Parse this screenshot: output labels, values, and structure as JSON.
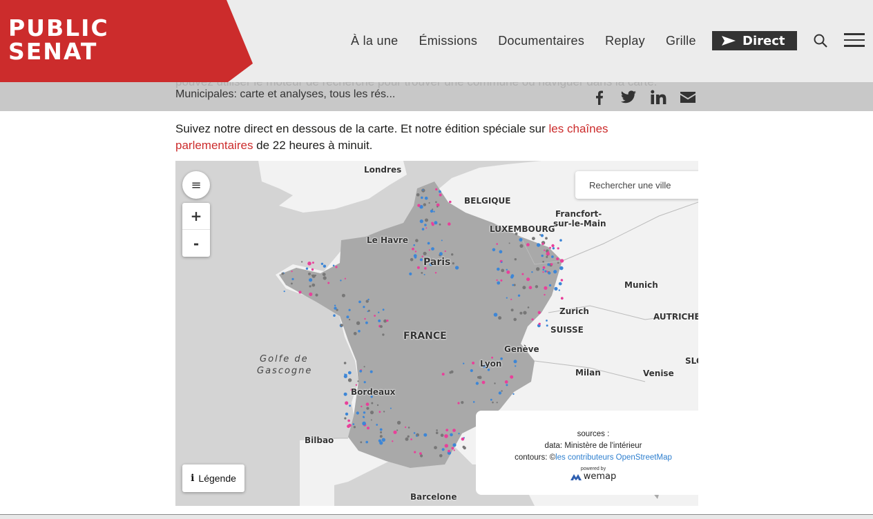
{
  "brand": {
    "logo_line1": "PUBLIC",
    "logo_line2": "SENAT",
    "color": "#cc2c2c"
  },
  "nav": {
    "items": [
      "À la une",
      "Émissions",
      "Documentaires",
      "Replay",
      "Grille"
    ],
    "direct_label": "Direct"
  },
  "share_bar": {
    "title": "Municipales: carte et analyses, tous les rés...",
    "behind_text": "pouvez utiliser le moteur de recherche pour trouver une commune ou naviguer dans la carte.",
    "icons": [
      "facebook-icon",
      "twitter-icon",
      "linkedin-icon",
      "mail-icon"
    ]
  },
  "article": {
    "text_before": "Suivez notre direct en dessous de la carte. Et notre édition spéciale sur ",
    "link_text": "les chaînes parlementaires",
    "text_after": " de 22 heures à minuit."
  },
  "map": {
    "search_placeholder": "Rechercher une ville",
    "zoom_in": "+",
    "zoom_out": "-",
    "legend_label": "Légende",
    "labels": {
      "londres": "Londres",
      "belgique": "BELGIQUE",
      "francfort1": "Francfort-",
      "francfort2": "sur-le-Main",
      "luxembourg": "LUXEMBOURG",
      "le_havre": "Le Havre",
      "paris": "Paris",
      "munich": "Munich",
      "zurich": "Zurich",
      "autriche": "AUTRICHE",
      "suisse": "SUISSE",
      "france": "FRANCE",
      "golfe1": "Golfe de",
      "golfe2": "Gascogne",
      "geneve": "Genève",
      "lyon": "Lyon",
      "slo": "SLO",
      "milan": "Milan",
      "venise": "Venise",
      "bordeaux": "Bordeaux",
      "bilbao": "Bilbao",
      "barcelone": "Barcelone"
    },
    "sources": {
      "title": "sources :",
      "data_line": "data: Ministère de l'intérieur",
      "contours_prefix": "contours: ©",
      "contours_link": "les contributeurs OpenStreetMap",
      "powered_by": "powered by",
      "wemap": "wemap"
    },
    "colors": {
      "land": "#f2f2f2",
      "sea": "#d4d4d4",
      "france": "#a9a9a9",
      "blue": "#3d86d6",
      "pink": "#e8409a"
    }
  }
}
